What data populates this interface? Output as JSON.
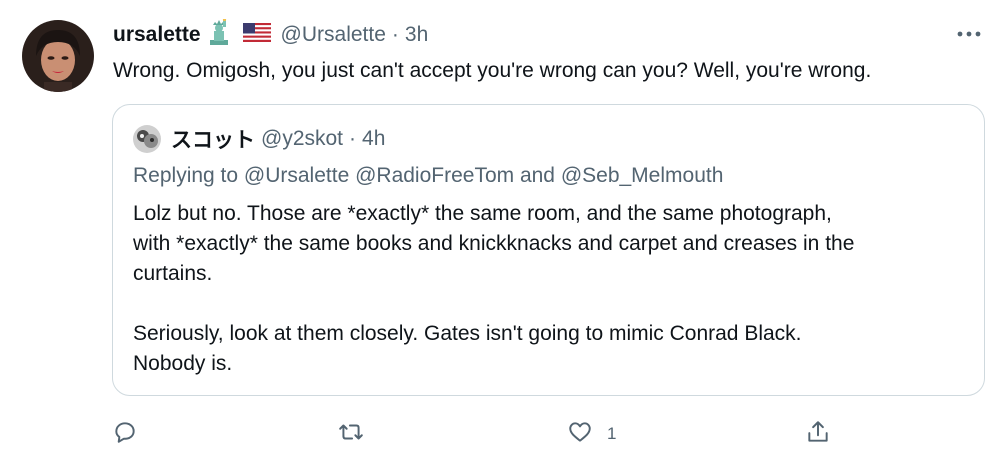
{
  "author": {
    "display_name": "ursalette",
    "badges": [
      "statue-of-liberty-icon",
      "us-flag-icon"
    ],
    "handle": "@Ursalette",
    "separator": "·",
    "time": "3h"
  },
  "tweet_text": "Wrong. Omigosh, you just can't accept you're wrong can you? Well, you're wrong.",
  "quoted": {
    "display_name": "スコット",
    "handle": "@y2skot",
    "separator": "·",
    "time": "4h",
    "replying_to": "Replying to @Ursalette @RadioFreeTom and @Seb_Melmouth",
    "text": "Lolz but no. Those are *exactly* the same room, and the same photograph,\nwith *exactly* the same books and knickknacks and carpet and creases in the\ncurtains.\n\nSeriously, look at them closely. Gates isn't going to mimic Conrad Black.\nNobody is."
  },
  "actions": {
    "reply_count": "",
    "retweet_count": "",
    "like_count": "1"
  },
  "colors": {
    "text": "#0f1419",
    "secondary": "#536471",
    "border": "#cfd9de"
  }
}
